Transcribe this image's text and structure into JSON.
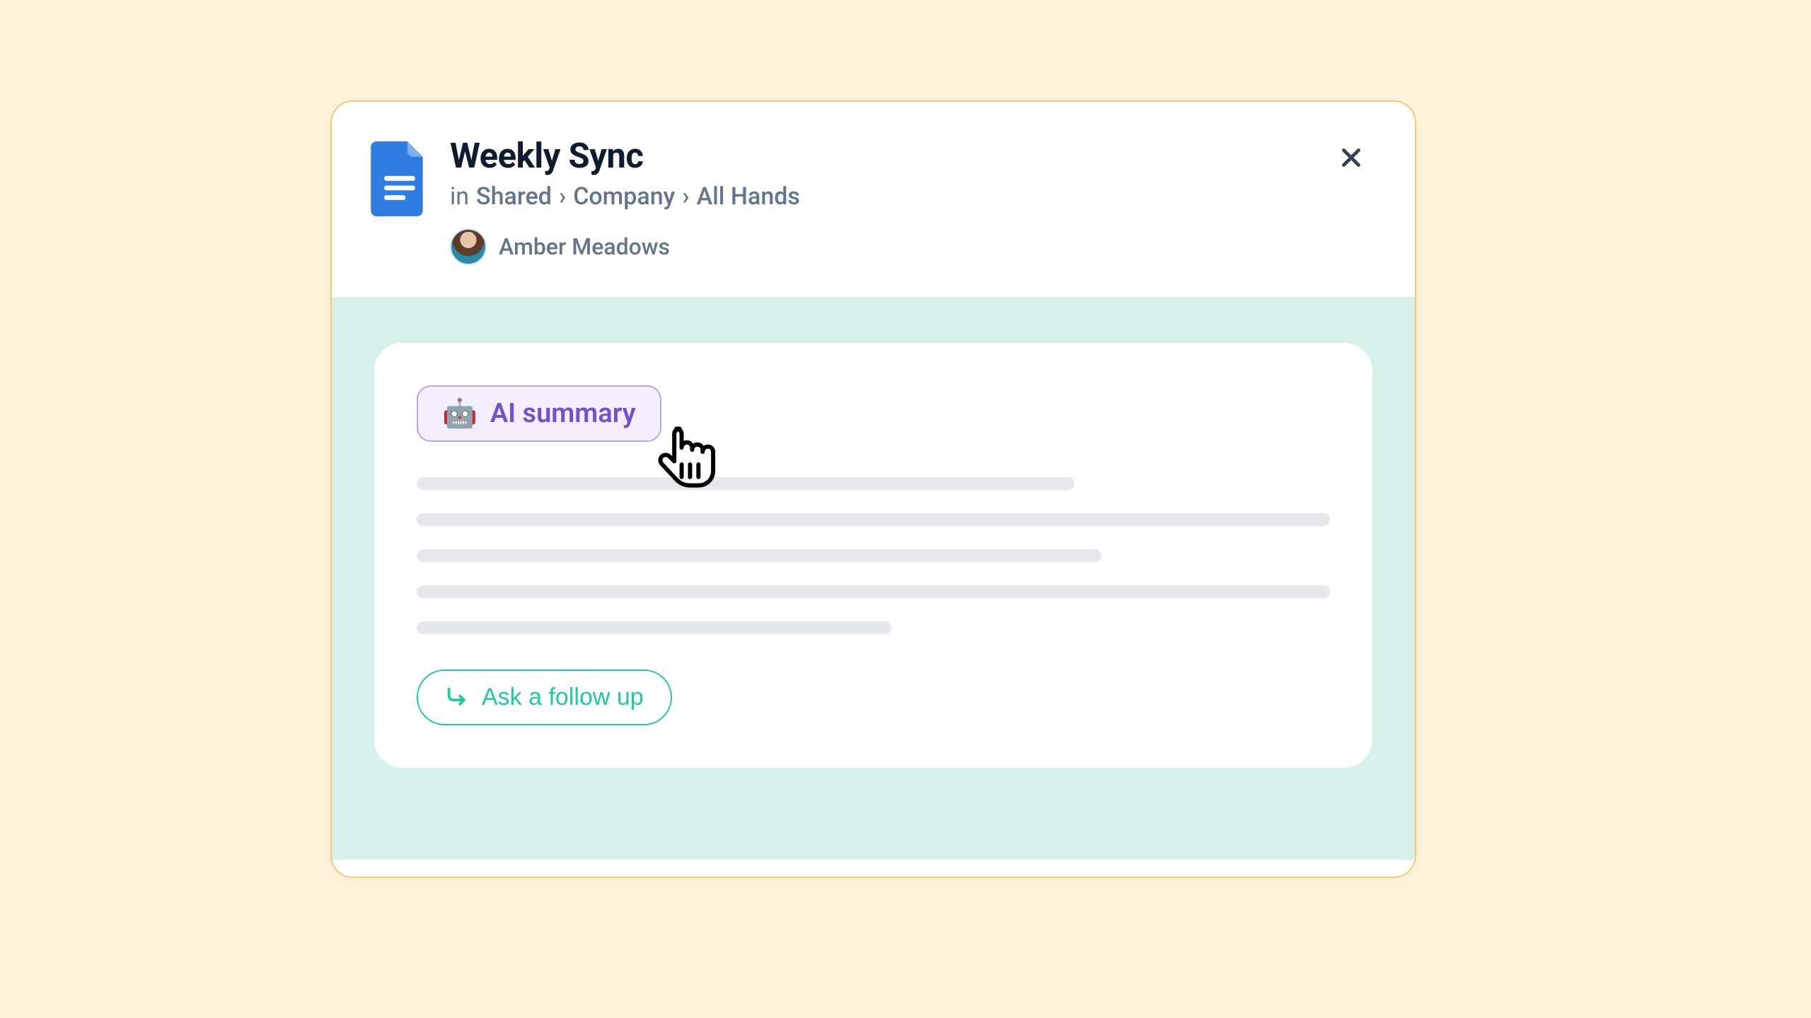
{
  "doc": {
    "title": "Weekly Sync",
    "breadcrumb_prefix": "in",
    "breadcrumb": [
      "Shared",
      "Company",
      "All Hands"
    ],
    "separator": "›",
    "author": "Amber Meadows"
  },
  "buttons": {
    "ai_summary": "AI summary",
    "follow_up": "Ask a follow up"
  },
  "icons": {
    "robot": "🤖"
  },
  "colors": {
    "page_bg": "#fdf4da",
    "panel_border": "#f0c97a",
    "body_bg": "#d5f1ea",
    "ai_chip_border": "#b8a6e8",
    "ai_chip_bg": "#f3efff",
    "ai_text": "#6d53d4",
    "follow_accent": "#1fc9a4",
    "doc_icon": "#2f7de1"
  }
}
